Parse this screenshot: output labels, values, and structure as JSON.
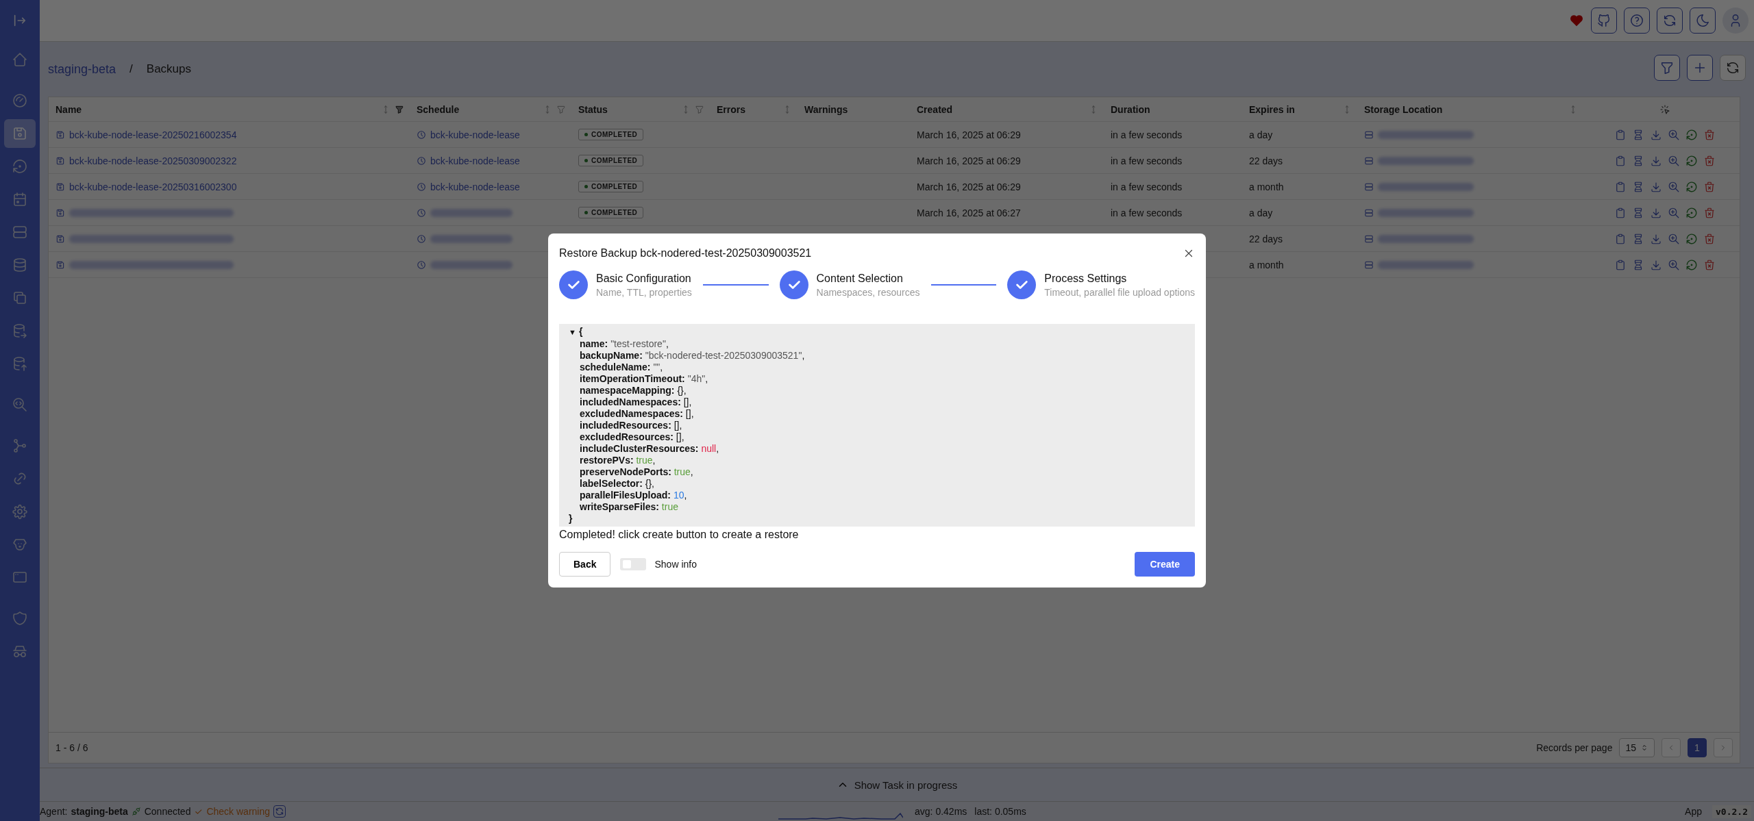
{
  "sidebar": {
    "items": [
      {
        "selected": false
      },
      {
        "selected": false
      },
      {
        "selected": true
      },
      {
        "selected": false
      },
      {
        "selected": false
      },
      {
        "selected": false
      },
      {
        "selected": false
      },
      {
        "selected": false
      },
      {
        "selected": false
      },
      {
        "selected": false
      },
      {
        "selected": false
      },
      {
        "selected": false
      },
      {
        "selected": false
      },
      {
        "selected": false
      },
      {
        "selected": false
      },
      {
        "selected": false
      },
      {
        "selected": false
      },
      {
        "selected": false
      }
    ]
  },
  "breadcrumb": {
    "parent": "staging-beta",
    "separator": "/",
    "current": "Backups"
  },
  "table": {
    "columns": [
      {
        "label": "Name",
        "sortable": true,
        "filterable": true,
        "filtered": true
      },
      {
        "label": "Schedule",
        "sortable": true,
        "filterable": true,
        "filtered": false
      },
      {
        "label": "Status",
        "sortable": true,
        "filterable": true,
        "filtered": false
      },
      {
        "label": "Errors",
        "sortable": true
      },
      {
        "label": "Warnings",
        "sortable": false
      },
      {
        "label": "Created",
        "sortable": true
      },
      {
        "label": "Duration",
        "sortable": false
      },
      {
        "label": "Expires in",
        "sortable": true
      },
      {
        "label": "Storage Location",
        "sortable": true
      }
    ],
    "rows": [
      {
        "name": "bck-kube-node-lease-20250216002354",
        "schedule": "bck-kube-node-lease",
        "status": "COMPLETED",
        "created": "March 16, 2025 at 06:29",
        "duration": "in a few seconds",
        "expires": "a day"
      },
      {
        "name": "bck-kube-node-lease-20250309002322",
        "schedule": "bck-kube-node-lease",
        "status": "COMPLETED",
        "created": "March 16, 2025 at 06:29",
        "duration": "in a few seconds",
        "expires": "22 days"
      },
      {
        "name": "bck-kube-node-lease-20250316002300",
        "schedule": "bck-kube-node-lease",
        "status": "COMPLETED",
        "created": "March 16, 2025 at 06:29",
        "duration": "in a few seconds",
        "expires": "a month"
      },
      {
        "status": "COMPLETED",
        "created": "March 16, 2025 at 06:27",
        "duration": "in a few seconds",
        "expires": "a day"
      },
      {
        "expires": "22 days"
      },
      {
        "expires": "a month"
      }
    ]
  },
  "footer": {
    "range": "1 - 6 / 6",
    "records_label": "Records per page",
    "page_size": "15",
    "pages": [
      {
        "label": "1",
        "selected": true
      }
    ]
  },
  "taskbar": {
    "label": "Show Task in progress"
  },
  "status_bar": {
    "agent_label": "Agent:",
    "agent": "staging-beta",
    "connection": "Connected",
    "check": "Check warning",
    "avg": "avg: 0.42ms",
    "last": "last: 0.05ms",
    "app_label": "App",
    "version": "v0.2.2"
  },
  "dialog": {
    "title": "Restore Backup bck-nodered-test-20250309003521",
    "steps": [
      {
        "title": "Basic Configuration",
        "subtitle": "Name, TTL, properties",
        "done": true
      },
      {
        "title": "Content Selection",
        "subtitle": "Namespaces, resources",
        "done": true
      },
      {
        "title": "Process Settings",
        "subtitle": "Timeout, parallel file upload options",
        "done": true
      }
    ],
    "json": {
      "toggle": "▼",
      "open": "{",
      "close": "}",
      "lines": [
        {
          "key": "name:",
          "value": "\"test-restore\"",
          "kind": "string",
          "punct": ","
        },
        {
          "key": "backupName:",
          "value": "\"bck-nodered-test-20250309003521\"",
          "kind": "string",
          "punct": ","
        },
        {
          "key": "scheduleName:",
          "value": "\"\"",
          "kind": "string",
          "punct": ","
        },
        {
          "key": "itemOperationTimeout:",
          "value": "\"4h\"",
          "kind": "string",
          "punct": ","
        },
        {
          "key": "namespaceMapping:",
          "value": "{}",
          "kind": "plain",
          "punct": ","
        },
        {
          "key": "includedNamespaces:",
          "value": "[]",
          "kind": "plain",
          "punct": ","
        },
        {
          "key": "excludedNamespaces:",
          "value": "[]",
          "kind": "plain",
          "punct": ","
        },
        {
          "key": "includedResources:",
          "value": "[]",
          "kind": "plain",
          "punct": ","
        },
        {
          "key": "excludedResources:",
          "value": "[]",
          "kind": "plain",
          "punct": ","
        },
        {
          "key": "includeClusterResources:",
          "value": "null",
          "kind": "null",
          "punct": ","
        },
        {
          "key": "restorePVs:",
          "value": "true",
          "kind": "bool",
          "punct": ","
        },
        {
          "key": "preserveNodePorts:",
          "value": "true",
          "kind": "bool",
          "punct": ","
        },
        {
          "key": "labelSelector:",
          "value": "{}",
          "kind": "plain",
          "punct": ","
        },
        {
          "key": "parallelFilesUpload:",
          "value": "10",
          "kind": "number",
          "punct": ","
        },
        {
          "key": "writeSparseFiles:",
          "value": "true",
          "kind": "bool"
        }
      ]
    },
    "message": "Completed! click create button to create a restore",
    "back": "Back",
    "show_info": {
      "label": "Show info",
      "on": false
    },
    "create": "Create"
  }
}
